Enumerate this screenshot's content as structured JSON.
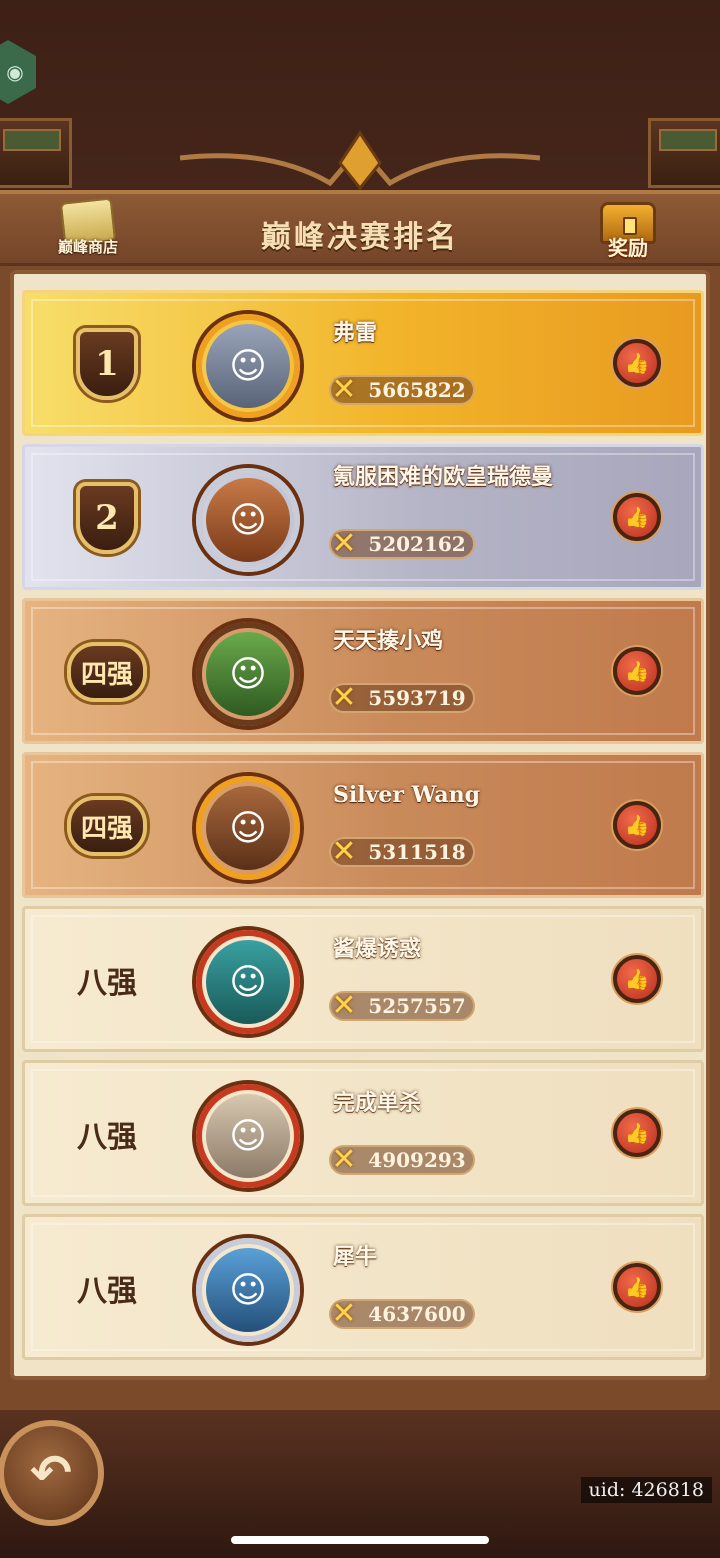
{
  "header": {
    "title": "巅峰决赛排名",
    "shop_label": "巅峰商店",
    "reward_label": "奖励"
  },
  "rankings": [
    {
      "rank": "1",
      "name": "弗雷",
      "score": "5665822",
      "tier": "gold"
    },
    {
      "rank": "2",
      "name": "氪服困难的欧皇瑞德曼",
      "score": "5202162",
      "tier": "silver"
    },
    {
      "rank": "四强",
      "name": "天天揍小鸡",
      "score": "5593719",
      "tier": "bronze"
    },
    {
      "rank": "四强",
      "name": "Silver Wang",
      "score": "5311518",
      "tier": "bronze"
    },
    {
      "rank": "八强",
      "name": "酱爆诱惑",
      "score": "5257557",
      "tier": "plain"
    },
    {
      "rank": "八强",
      "name": "完成单杀",
      "score": "4909293",
      "tier": "plain"
    },
    {
      "rank": "八强",
      "name": "犀牛",
      "score": "4637600",
      "tier": "plain"
    }
  ],
  "footer": {
    "uid": "uid: 426818"
  },
  "icons": {
    "like": "thumbs-up-icon",
    "score": "crossed-swords-icon",
    "back": "back-arrow-icon"
  },
  "colors": {
    "gold_row": "#f2b42a",
    "silver_row": "#b4b4c6",
    "bronze_row": "#c98a5a",
    "plain_row": "#f6ead0"
  }
}
